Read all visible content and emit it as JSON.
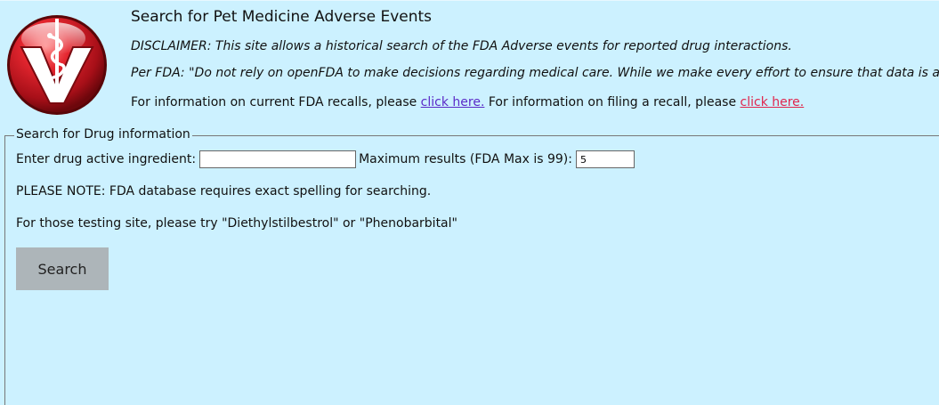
{
  "header": {
    "title": "Search for Pet Medicine Adverse Events",
    "disclaimer": "DISCLAIMER: This site allows a historical search of the FDA Adverse events for reported drug interactions.",
    "fda_quote": "Per FDA: \"Do not rely on openFDA to make decisions regarding medical care. While we make every effort to ensure that data is a",
    "recall_prefix": "For information on current FDA recalls, please ",
    "recall_link": "click here.",
    "filing_prefix": " For information on filing a recall, please ",
    "filing_link": "click here."
  },
  "logo": {
    "icon": "veterinary-caduceus-v-logo",
    "letter": "V",
    "colors": {
      "red": "#d31f2a",
      "dark_red": "#8a0b12",
      "white": "#ffffff"
    }
  },
  "search_form": {
    "legend": "Search for Drug information",
    "ingredient_label": "Enter drug active ingredient:",
    "ingredient_value": "",
    "max_results_label": "Maximum results (FDA Max is 99):",
    "max_results_value": "5",
    "note_spelling": "PLEASE NOTE: FDA database requires exact spelling for searching.",
    "note_testing": "For those testing site, please try \"Diethylstilbestrol\" or \"Phenobarbital\"",
    "search_button": "Search"
  },
  "colors": {
    "background": "#ccf1ff",
    "link_visited": "#5b2bc8",
    "link_red": "#e0264d",
    "button": "#adb5b9"
  }
}
